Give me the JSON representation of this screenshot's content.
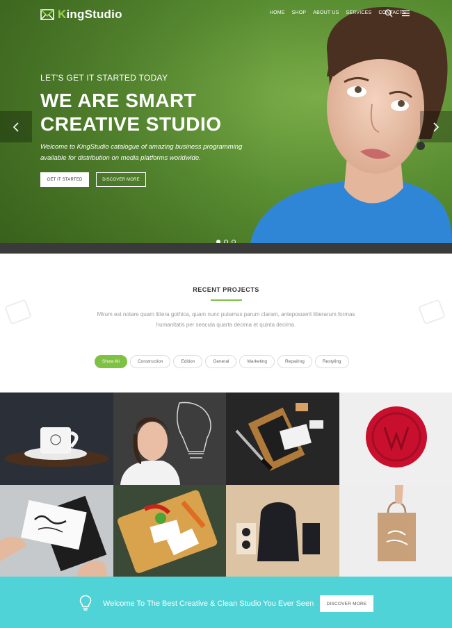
{
  "header": {
    "logo_text_accent": "K",
    "logo_text_rest": "ingStudio",
    "nav": [
      "HOME",
      "SHOP",
      "ABOUT US",
      "SERVICES",
      "CONTACTS"
    ],
    "icons": {
      "search": "search-icon",
      "menu": "hamburger-menu-icon",
      "logo": "envelope-logo-icon"
    }
  },
  "hero": {
    "kicker": "LET'S GET IT STARTED TODAY",
    "title": "WE ARE SMART CREATIVE STUDIO",
    "description": "Welcome to KingStudio catalogue of amazing business programming available for distribution on media platforms worldwide.",
    "primary_button": "GET IT STARTED",
    "secondary_button": "DISCOVER MORE",
    "slide_count": 3,
    "active_slide": 1
  },
  "projects": {
    "title": "RECENT PROJECTS",
    "description": "Mirum est notare quam littera gothica, quam nunc putamus parum claram, anteposuerit litterarum formas humanitatis per seacula quarta decima et quinta decima.",
    "filters": [
      "Show All",
      "Construction",
      "Edition",
      "General",
      "Marketing",
      "Repairing",
      "Restyling"
    ],
    "active_filter": "Show All"
  },
  "cta": {
    "text": "Welcome To The Best Creative & Clean Studio You Ever Seen",
    "button": "DISCOVER MORE",
    "icon": "lightbulb-icon"
  },
  "colors": {
    "accent_green": "#7fc142",
    "hero_green": "#5b8f33",
    "cta_cyan": "#4fd3d6",
    "dark_strip": "#3a3a3a"
  }
}
